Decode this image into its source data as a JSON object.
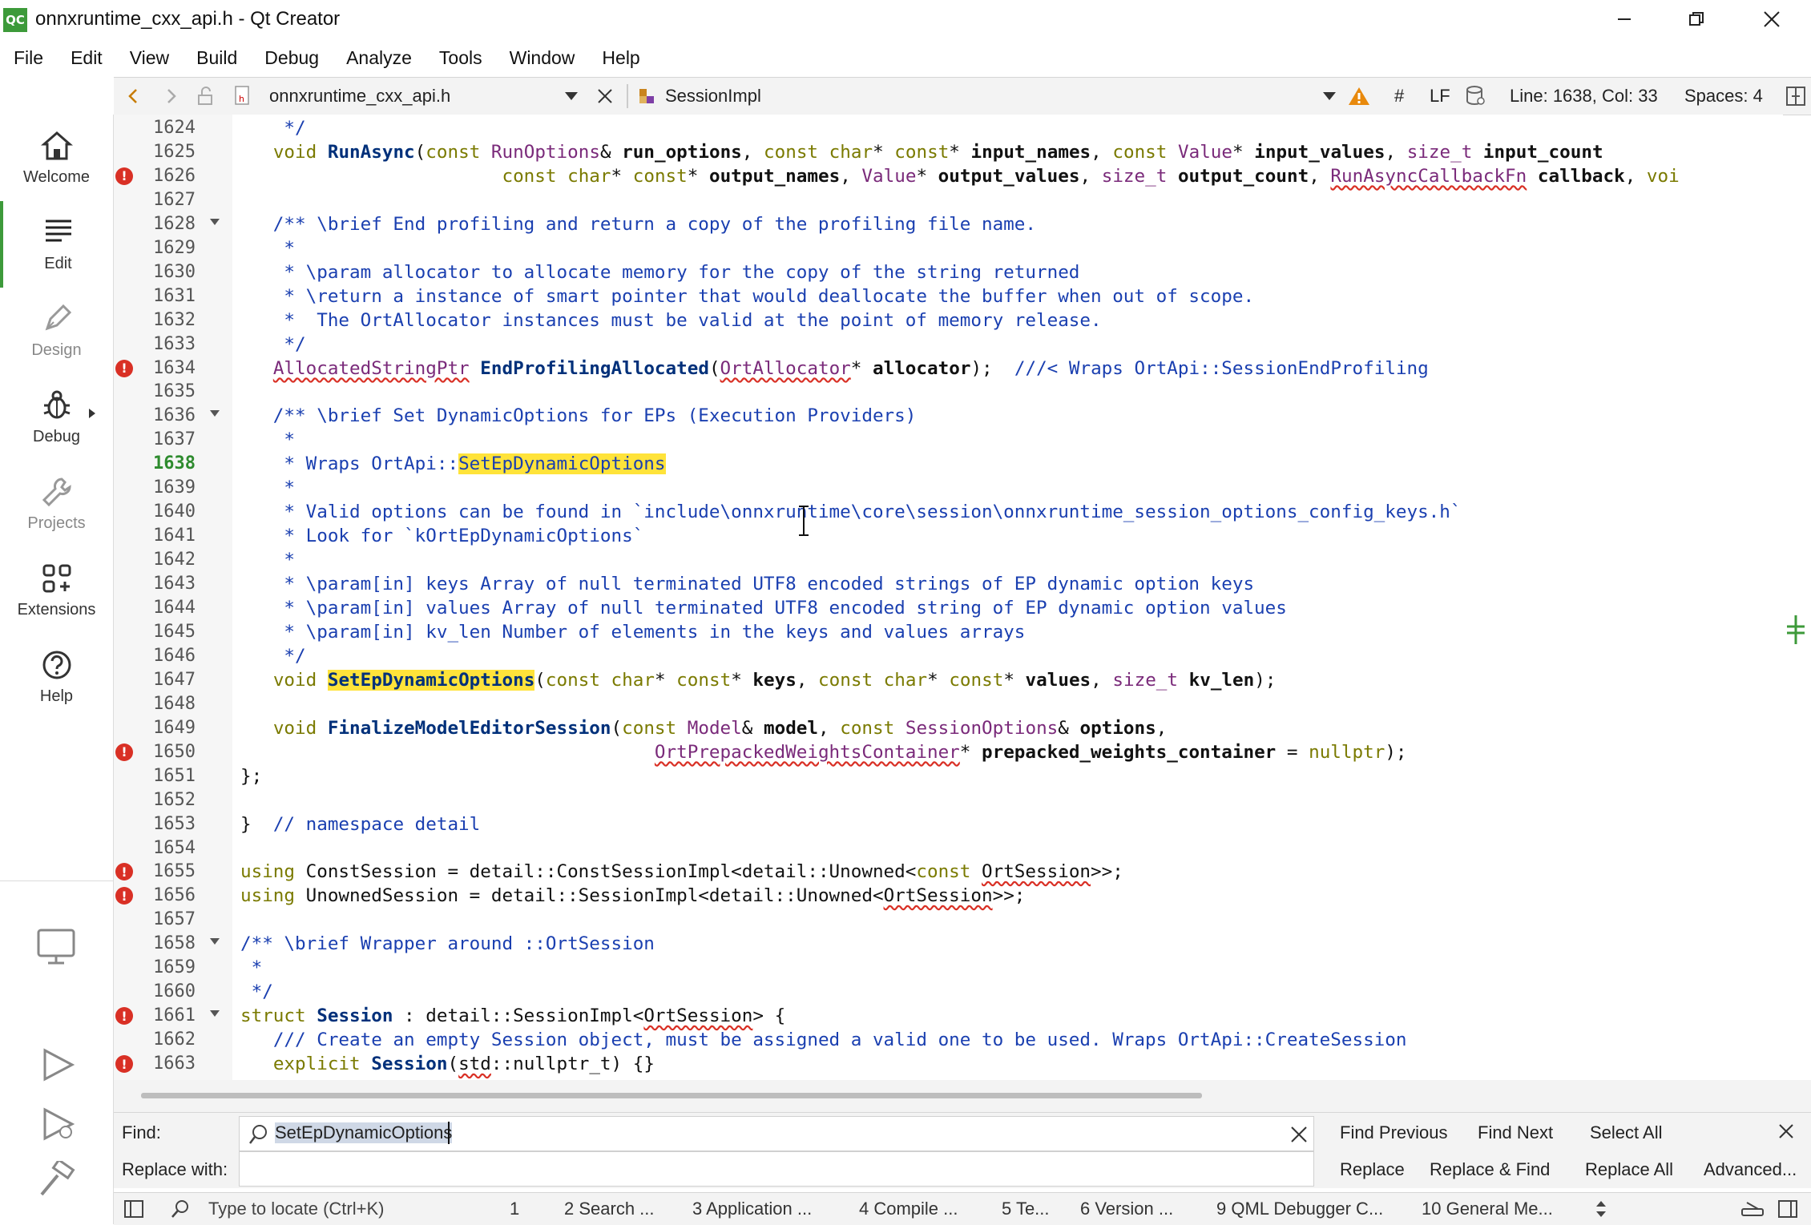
{
  "window": {
    "logo_text": "QC",
    "title": "onnxruntime_cxx_api.h - Qt Creator"
  },
  "menu": [
    "File",
    "Edit",
    "View",
    "Build",
    "Debug",
    "Analyze",
    "Tools",
    "Window",
    "Help"
  ],
  "toolbar": {
    "file_name": "onnxruntime_cxx_api.h",
    "symbol": "SessionImpl",
    "hash": "#",
    "line_ending": "LF",
    "cursor_position": "Line: 1638, Col: 33",
    "indentation": "Spaces: 4"
  },
  "modes": [
    {
      "label": "Welcome",
      "icon": "home-icon"
    },
    {
      "label": "Edit",
      "icon": "edit-lines-icon"
    },
    {
      "label": "Design",
      "icon": "pen-icon"
    },
    {
      "label": "Debug",
      "icon": "bug-icon"
    },
    {
      "label": "Projects",
      "icon": "wrench-icon"
    },
    {
      "label": "Extensions",
      "icon": "extensions-icon"
    },
    {
      "label": "Help",
      "icon": "help-icon"
    }
  ],
  "editor": {
    "current_line": "1638",
    "lines": [
      {
        "n": "1624"
      },
      {
        "n": "1625"
      },
      {
        "n": "1626",
        "err": true
      },
      {
        "n": "1627"
      },
      {
        "n": "1628",
        "fold": true
      },
      {
        "n": "1629"
      },
      {
        "n": "1630"
      },
      {
        "n": "1631"
      },
      {
        "n": "1632"
      },
      {
        "n": "1633"
      },
      {
        "n": "1634",
        "err": true
      },
      {
        "n": "1635"
      },
      {
        "n": "1636",
        "fold": true
      },
      {
        "n": "1637"
      },
      {
        "n": "1638"
      },
      {
        "n": "1639"
      },
      {
        "n": "1640"
      },
      {
        "n": "1641"
      },
      {
        "n": "1642"
      },
      {
        "n": "1643"
      },
      {
        "n": "1644"
      },
      {
        "n": "1645"
      },
      {
        "n": "1646"
      },
      {
        "n": "1647"
      },
      {
        "n": "1648"
      },
      {
        "n": "1649"
      },
      {
        "n": "1650",
        "err": true
      },
      {
        "n": "1651"
      },
      {
        "n": "1652"
      },
      {
        "n": "1653"
      },
      {
        "n": "1654"
      },
      {
        "n": "1655",
        "err": true
      },
      {
        "n": "1656",
        "err": true
      },
      {
        "n": "1657"
      },
      {
        "n": "1658",
        "fold": true
      },
      {
        "n": "1659"
      },
      {
        "n": "1660"
      },
      {
        "n": "1661",
        "err": true,
        "fold": true
      },
      {
        "n": "1662"
      },
      {
        "n": "1663",
        "err": true
      }
    ],
    "code": [
      [
        {
          "t": "    */",
          "c": "cm"
        }
      ],
      [
        {
          "t": "   "
        },
        {
          "t": "void",
          "c": "kw"
        },
        {
          "t": " "
        },
        {
          "t": "RunAsync",
          "c": "fn"
        },
        {
          "t": "("
        },
        {
          "t": "const",
          "c": "kw"
        },
        {
          "t": " "
        },
        {
          "t": "RunOptions",
          "c": "ty"
        },
        {
          "t": "& "
        },
        {
          "t": "run_options",
          "c": "pv"
        },
        {
          "t": ", "
        },
        {
          "t": "const",
          "c": "kw"
        },
        {
          "t": " "
        },
        {
          "t": "char",
          "c": "kw"
        },
        {
          "t": "* "
        },
        {
          "t": "const",
          "c": "kw"
        },
        {
          "t": "* "
        },
        {
          "t": "input_names",
          "c": "pv"
        },
        {
          "t": ", "
        },
        {
          "t": "const",
          "c": "kw"
        },
        {
          "t": " "
        },
        {
          "t": "Value",
          "c": "ty"
        },
        {
          "t": "* "
        },
        {
          "t": "input_values",
          "c": "pv"
        },
        {
          "t": ", "
        },
        {
          "t": "size_t",
          "c": "ty"
        },
        {
          "t": " "
        },
        {
          "t": "input_count",
          "c": "pv"
        }
      ],
      [
        {
          "t": "                        "
        },
        {
          "t": "const",
          "c": "kw"
        },
        {
          "t": " "
        },
        {
          "t": "char",
          "c": "kw"
        },
        {
          "t": "* "
        },
        {
          "t": "const",
          "c": "kw"
        },
        {
          "t": "* "
        },
        {
          "t": "output_names",
          "c": "pv"
        },
        {
          "t": ", "
        },
        {
          "t": "Value",
          "c": "ty"
        },
        {
          "t": "* "
        },
        {
          "t": "output_values",
          "c": "pv"
        },
        {
          "t": ", "
        },
        {
          "t": "size_t",
          "c": "ty"
        },
        {
          "t": " "
        },
        {
          "t": "output_count",
          "c": "pv"
        },
        {
          "t": ", "
        },
        {
          "t": "RunAsyncCallbackFn",
          "c": "ty ul"
        },
        {
          "t": " "
        },
        {
          "t": "callback",
          "c": "pv"
        },
        {
          "t": ", "
        },
        {
          "t": "voi",
          "c": "kw"
        }
      ],
      [],
      [
        {
          "t": "   /** \\brief End profiling and return a copy of the profiling file name.",
          "c": "cm"
        }
      ],
      [
        {
          "t": "    *",
          "c": "cm"
        }
      ],
      [
        {
          "t": "    * \\param allocator to allocate memory for the copy of the string returned",
          "c": "cm"
        }
      ],
      [
        {
          "t": "    * \\return a instance of smart pointer that would deallocate the buffer when out of scope.",
          "c": "cm"
        }
      ],
      [
        {
          "t": "    *  The OrtAllocator instances must be valid at the point of memory release.",
          "c": "cm"
        }
      ],
      [
        {
          "t": "    */",
          "c": "cm"
        }
      ],
      [
        {
          "t": "   "
        },
        {
          "t": "AllocatedStringPtr",
          "c": "ty ul"
        },
        {
          "t": " "
        },
        {
          "t": "EndProfilingAllocated",
          "c": "fn"
        },
        {
          "t": "("
        },
        {
          "t": "OrtAllocator",
          "c": "ty ul"
        },
        {
          "t": "* "
        },
        {
          "t": "allocator",
          "c": "pv"
        },
        {
          "t": ");  "
        },
        {
          "t": "///< Wraps OrtApi::SessionEndProfiling",
          "c": "cm"
        }
      ],
      [],
      [
        {
          "t": "   /** \\brief Set DynamicOptions for EPs (Execution Providers)",
          "c": "cm"
        }
      ],
      [
        {
          "t": "    *",
          "c": "cm"
        }
      ],
      [
        {
          "t": "    * Wraps OrtApi::",
          "c": "cm"
        },
        {
          "t": "SetEpDynamicOptions",
          "c": "cm hl"
        }
      ],
      [
        {
          "t": "    *",
          "c": "cm"
        }
      ],
      [
        {
          "t": "    * Valid options can be found in `include\\onnxruntime\\core\\session\\onnxruntime_session_options_config_keys.h`",
          "c": "cm"
        }
      ],
      [
        {
          "t": "    * Look for `kOrtEpDynamicOptions`",
          "c": "cm"
        }
      ],
      [
        {
          "t": "    *",
          "c": "cm"
        }
      ],
      [
        {
          "t": "    * \\param[in] keys Array of null terminated UTF8 encoded strings of EP dynamic option keys",
          "c": "cm"
        }
      ],
      [
        {
          "t": "    * \\param[in] values Array of null terminated UTF8 encoded string of EP dynamic option values",
          "c": "cm"
        }
      ],
      [
        {
          "t": "    * \\param[in] kv_len Number of elements in the keys and values arrays",
          "c": "cm"
        }
      ],
      [
        {
          "t": "    */",
          "c": "cm"
        }
      ],
      [
        {
          "t": "   "
        },
        {
          "t": "void",
          "c": "kw"
        },
        {
          "t": " "
        },
        {
          "t": "SetEpDynamicOptions",
          "c": "fn hl"
        },
        {
          "t": "("
        },
        {
          "t": "const",
          "c": "kw"
        },
        {
          "t": " "
        },
        {
          "t": "char",
          "c": "kw"
        },
        {
          "t": "* "
        },
        {
          "t": "const",
          "c": "kw"
        },
        {
          "t": "* "
        },
        {
          "t": "keys",
          "c": "pv"
        },
        {
          "t": ", "
        },
        {
          "t": "const",
          "c": "kw"
        },
        {
          "t": " "
        },
        {
          "t": "char",
          "c": "kw"
        },
        {
          "t": "* "
        },
        {
          "t": "const",
          "c": "kw"
        },
        {
          "t": "* "
        },
        {
          "t": "values",
          "c": "pv"
        },
        {
          "t": ", "
        },
        {
          "t": "size_t",
          "c": "ty"
        },
        {
          "t": " "
        },
        {
          "t": "kv_len",
          "c": "pv"
        },
        {
          "t": ");"
        }
      ],
      [],
      [
        {
          "t": "   "
        },
        {
          "t": "void",
          "c": "kw"
        },
        {
          "t": " "
        },
        {
          "t": "FinalizeModelEditorSession",
          "c": "fn"
        },
        {
          "t": "("
        },
        {
          "t": "const",
          "c": "kw"
        },
        {
          "t": " "
        },
        {
          "t": "Model",
          "c": "ty"
        },
        {
          "t": "& "
        },
        {
          "t": "model",
          "c": "pv"
        },
        {
          "t": ", "
        },
        {
          "t": "const",
          "c": "kw"
        },
        {
          "t": " "
        },
        {
          "t": "SessionOptions",
          "c": "ty"
        },
        {
          "t": "& "
        },
        {
          "t": "options",
          "c": "pv"
        },
        {
          "t": ","
        }
      ],
      [
        {
          "t": "                                      "
        },
        {
          "t": "OrtPrepackedWeightsContainer",
          "c": "ty ul"
        },
        {
          "t": "* "
        },
        {
          "t": "prepacked_weights_container",
          "c": "pv"
        },
        {
          "t": " = "
        },
        {
          "t": "nullptr",
          "c": "np"
        },
        {
          "t": ");"
        }
      ],
      [
        {
          "t": "};"
        }
      ],
      [],
      [
        {
          "t": "}  "
        },
        {
          "t": "// namespace detail",
          "c": "cm"
        }
      ],
      [],
      [
        {
          "t": "using",
          "c": "kw"
        },
        {
          "t": " ConstSession = detail::ConstSessionImpl<detail::Unowned<"
        },
        {
          "t": "const",
          "c": "kw"
        },
        {
          "t": " "
        },
        {
          "t": "OrtSession",
          "c": "ul"
        },
        {
          "t": ">>;"
        }
      ],
      [
        {
          "t": "using",
          "c": "kw"
        },
        {
          "t": " UnownedSession = detail::SessionImpl<detail::Unowned<"
        },
        {
          "t": "OrtSession",
          "c": "ul"
        },
        {
          "t": ">>;"
        }
      ],
      [],
      [
        {
          "t": "/** \\brief Wrapper around ::OrtSession",
          "c": "cm"
        }
      ],
      [
        {
          "t": " *",
          "c": "cm"
        }
      ],
      [
        {
          "t": " */",
          "c": "cm"
        }
      ],
      [
        {
          "t": "struct",
          "c": "kw"
        },
        {
          "t": " "
        },
        {
          "t": "Session",
          "c": "fn"
        },
        {
          "t": " : detail::SessionImpl<"
        },
        {
          "t": "OrtSession",
          "c": "ul"
        },
        {
          "t": "> {"
        }
      ],
      [
        {
          "t": "   "
        },
        {
          "t": "/// Create an empty Session object, must be assigned a valid one to be used. Wraps OrtApi::CreateSession",
          "c": "cm"
        }
      ],
      [
        {
          "t": "   "
        },
        {
          "t": "explicit",
          "c": "kw"
        },
        {
          "t": " "
        },
        {
          "t": "Session",
          "c": "fn"
        },
        {
          "t": "("
        },
        {
          "t": "std",
          "c": "ul"
        },
        {
          "t": "::nullptr_t) {}"
        }
      ]
    ]
  },
  "find": {
    "find_label": "Find:",
    "find_value": "SetEpDynamicOptions",
    "replace_label": "Replace with:",
    "replace_value": "",
    "buttons": {
      "find_previous": "Find Previous",
      "find_next": "Find Next",
      "select_all": "Select All",
      "replace": "Replace",
      "replace_find": "Replace & Find",
      "replace_all": "Replace All",
      "advanced": "Advanced..."
    }
  },
  "statusbar": {
    "locator_placeholder": "Type to locate (Ctrl+K)",
    "panes": [
      "1",
      "2  Search ...",
      "3  Application ...",
      "4  Compile ...",
      "5  Te...",
      "6  Version ...",
      "9  QML Debugger C...",
      "10  General Me..."
    ]
  },
  "colors": {
    "accent_green": "#3d9a3a",
    "error_red": "#d93025",
    "highlight_yellow": "#ffe33a",
    "comment_blue": "#1a3fb0"
  }
}
